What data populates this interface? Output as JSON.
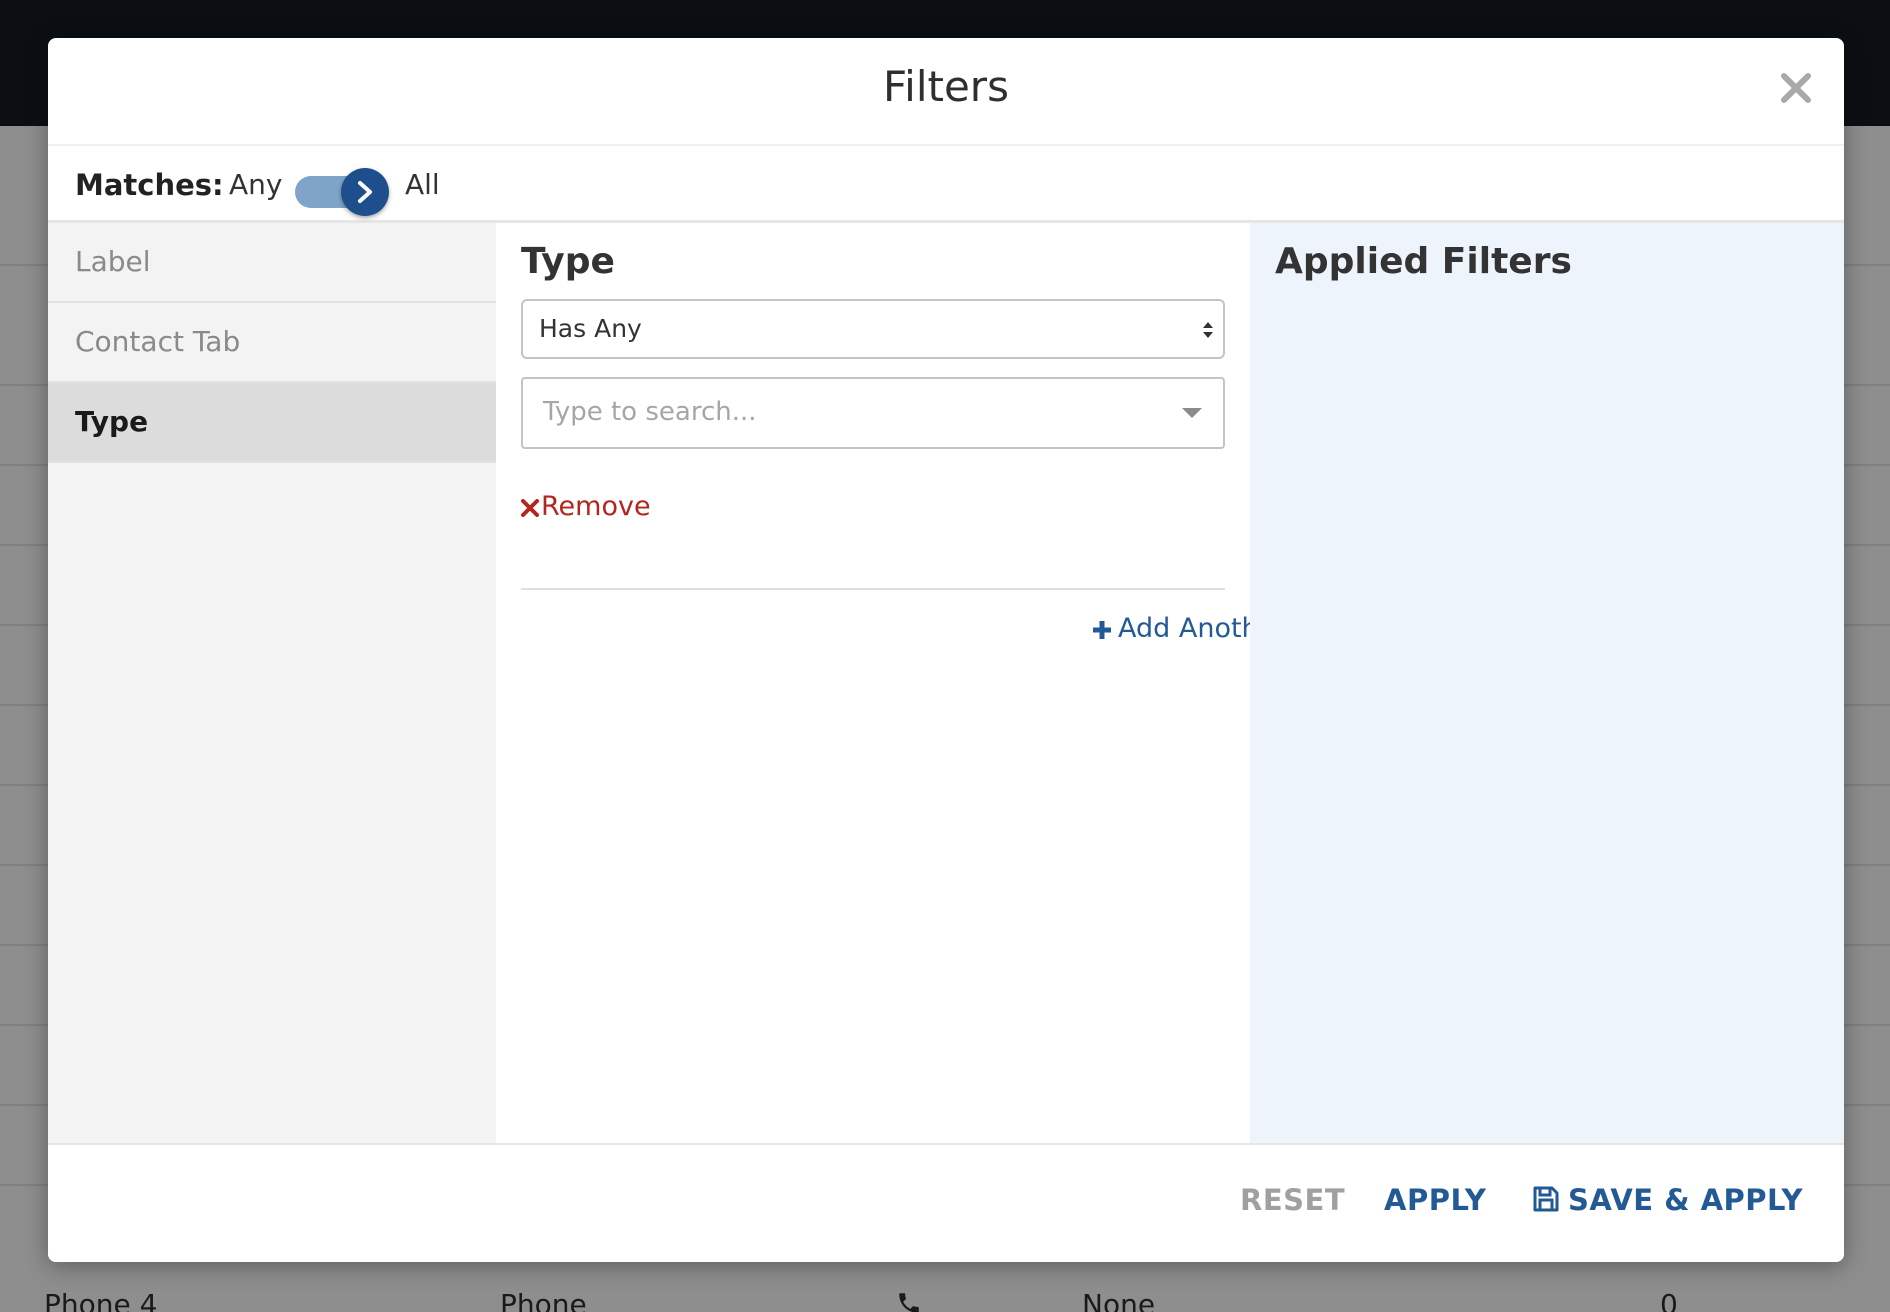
{
  "modal": {
    "title": "Filters",
    "close_icon": "close-icon"
  },
  "matches": {
    "label": "Matches:",
    "option_any": "Any",
    "option_all": "All",
    "selected": "All"
  },
  "nav": {
    "items": [
      {
        "label": "Label",
        "active": false
      },
      {
        "label": "Contact Tab",
        "active": false
      },
      {
        "label": "Type",
        "active": true
      }
    ]
  },
  "editor": {
    "title": "Type",
    "operator_value": "Has Any",
    "search_placeholder": "Type to search...",
    "remove_label": "Remove",
    "add_another_label": "Add Another"
  },
  "applied": {
    "title": "Applied Filters"
  },
  "footer": {
    "reset_label": "RESET",
    "apply_label": "APPLY",
    "save_apply_label": "SAVE & APPLY"
  },
  "background": {
    "row": {
      "name": "Phone 4",
      "type": "Phone",
      "number": "None",
      "count": "0"
    }
  },
  "colors": {
    "accent": "#235a96",
    "toggle_knob": "#1e4f8c",
    "danger": "#b3261e",
    "applied_bg": "#eef4fc"
  }
}
